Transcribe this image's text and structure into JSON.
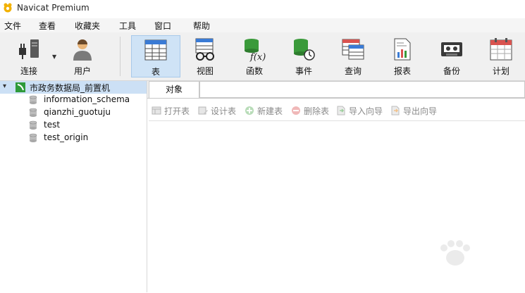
{
  "window": {
    "title": "Navicat Premium"
  },
  "menubar": {
    "items": [
      "文件",
      "查看",
      "收藏夹",
      "工具",
      "窗口",
      "帮助"
    ]
  },
  "toolbar": {
    "buttons": [
      {
        "label": "连接",
        "icon": "plug-icon",
        "has_dropdown": true
      },
      {
        "label": "用户",
        "icon": "user-icon"
      },
      {
        "label": "表",
        "icon": "table-icon",
        "active": true
      },
      {
        "label": "视图",
        "icon": "view-icon"
      },
      {
        "label": "函数",
        "icon": "function-icon"
      },
      {
        "label": "事件",
        "icon": "event-icon"
      },
      {
        "label": "查询",
        "icon": "query-icon"
      },
      {
        "label": "报表",
        "icon": "report-icon"
      },
      {
        "label": "备份",
        "icon": "backup-icon"
      },
      {
        "label": "计划",
        "icon": "schedule-icon"
      }
    ]
  },
  "sidebar": {
    "connection": {
      "label": "市政务数据局_前置机",
      "expanded": true
    },
    "databases": [
      "information_schema",
      "qianzhi_guotuju",
      "test",
      "test_origin"
    ]
  },
  "main": {
    "tab": "对象",
    "object_toolbar": [
      "打开表",
      "设计表",
      "新建表",
      "删除表",
      "导入向导",
      "导出向导"
    ]
  },
  "colors": {
    "accent": "#2e7bd6",
    "active_bg": "#cfe3f6",
    "selected_row": "#cce0f5",
    "disabled_text": "#8a8a8a"
  }
}
